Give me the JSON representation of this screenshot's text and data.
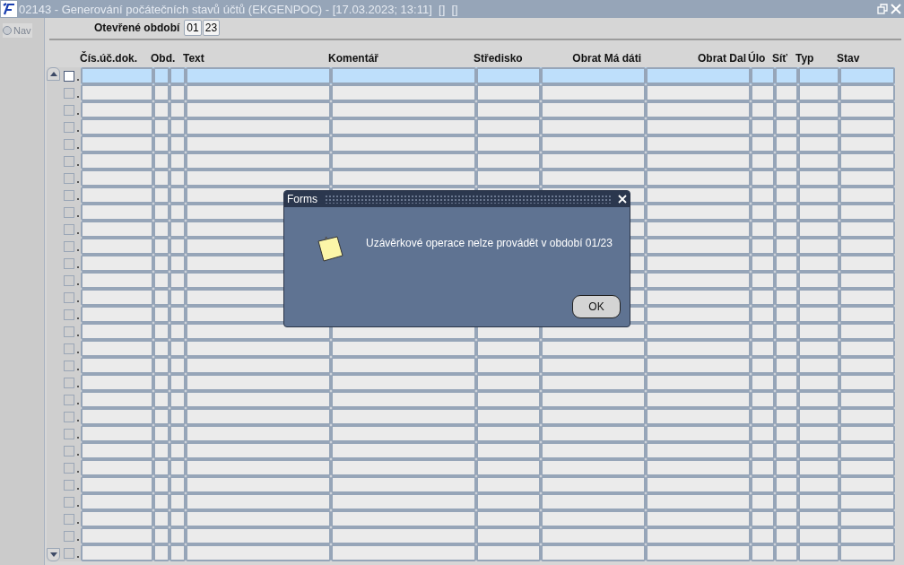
{
  "window": {
    "title": "02143 - Generování počátečních stavů účtů (EKGENPOC) - [17.03.2023; 13:11]  []  []"
  },
  "nav": {
    "label": "Nav",
    "selected": false
  },
  "period": {
    "label": "Otevřené období",
    "month": "01",
    "year": "23"
  },
  "table": {
    "columns": [
      {
        "label": "Čís.úč.dok.",
        "kind": "text"
      },
      {
        "label": "Obd.",
        "kind": "text"
      },
      {
        "kind": "text"
      },
      {
        "label": "Text",
        "kind": "text"
      },
      {
        "label": "Komentář",
        "kind": "text"
      },
      {
        "label": "Středisko",
        "kind": "text"
      },
      {
        "label": "Obrat Má dáti",
        "kind": "numeric"
      },
      {
        "label": "Obrat Dal",
        "kind": "numeric"
      },
      {
        "label": "Úlo",
        "kind": "text"
      },
      {
        "label": "Síť",
        "kind": "text"
      },
      {
        "label": "Typ",
        "kind": "text"
      },
      {
        "label": "Stav",
        "kind": "text"
      }
    ],
    "rows": [
      {
        "selected": true
      },
      {
        "selected": false
      },
      {
        "selected": false
      },
      {
        "selected": false
      },
      {
        "selected": false
      },
      {
        "selected": false
      },
      {
        "selected": false
      },
      {
        "selected": false
      },
      {
        "selected": false
      },
      {
        "selected": false
      },
      {
        "selected": false
      },
      {
        "selected": false
      },
      {
        "selected": false
      },
      {
        "selected": false
      },
      {
        "selected": false
      },
      {
        "selected": false
      },
      {
        "selected": false
      },
      {
        "selected": false
      },
      {
        "selected": false
      },
      {
        "selected": false
      },
      {
        "selected": false
      },
      {
        "selected": false
      },
      {
        "selected": false
      },
      {
        "selected": false
      },
      {
        "selected": false
      },
      {
        "selected": false
      },
      {
        "selected": false
      },
      {
        "selected": false
      },
      {
        "selected": false
      }
    ]
  },
  "dialog": {
    "title": "Forms",
    "message": "Uzávěrkové operace nelze provádět v období 01/23",
    "button": "OK"
  }
}
